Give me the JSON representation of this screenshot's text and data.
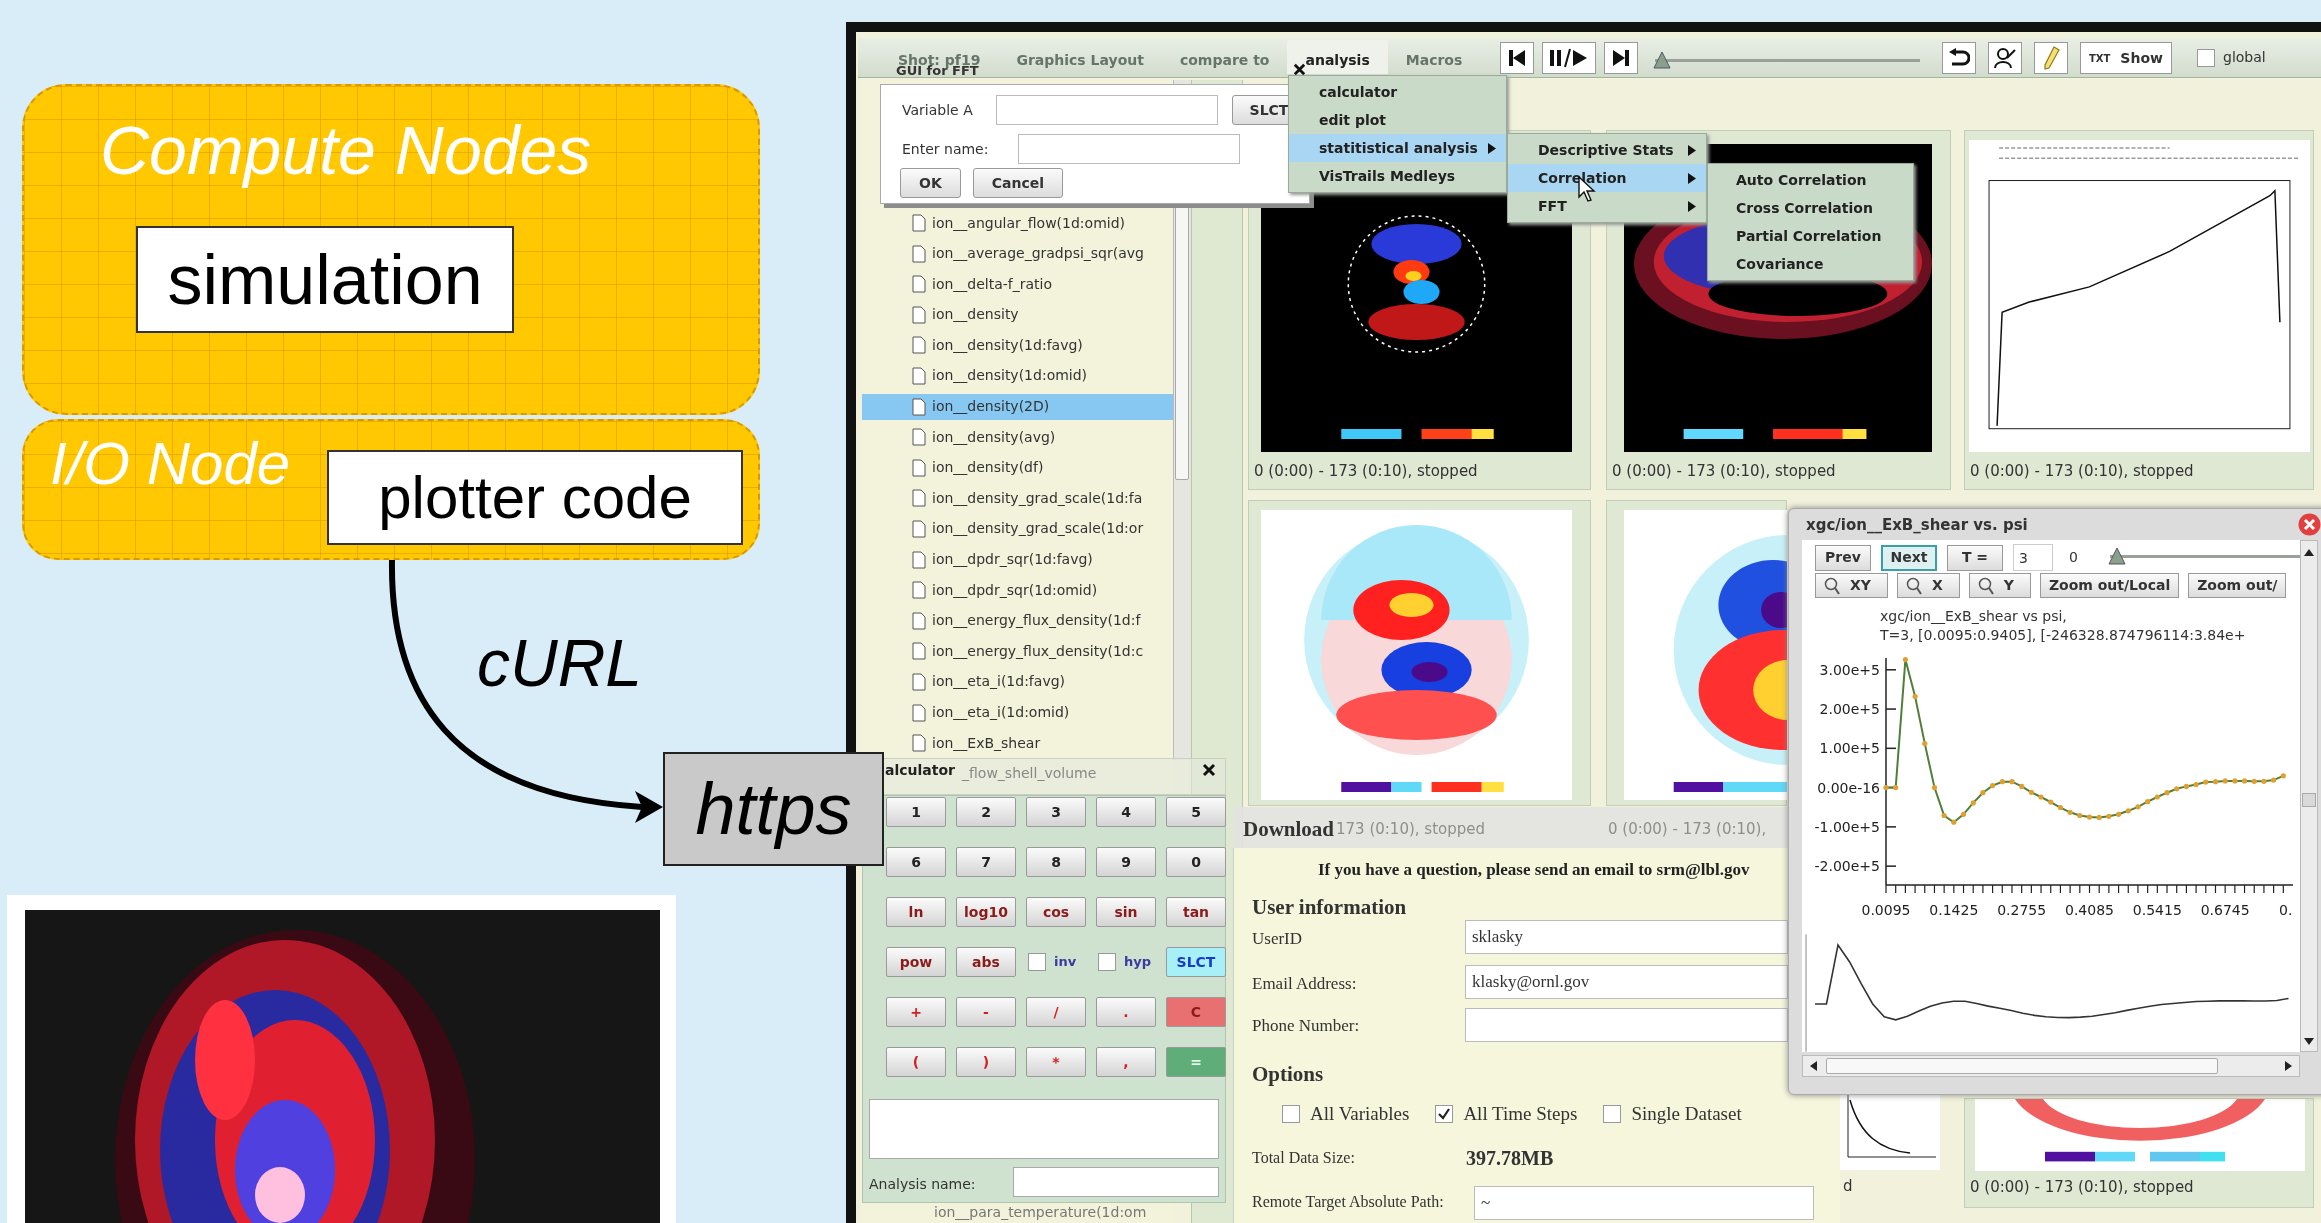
{
  "slide": {
    "compute_nodes": {
      "title": "Compute Nodes",
      "process": "simulation"
    },
    "io_node": {
      "title": "I/O Node",
      "process": "plotter code"
    },
    "transfer_label": "cURL",
    "endpoint": "https"
  },
  "app": {
    "menu_tabs": [
      {
        "label": "Shot: pf19",
        "selected": false
      },
      {
        "label": "Graphics Layout",
        "selected": false
      },
      {
        "label": "compare to",
        "selected": false
      },
      {
        "label": "analysis",
        "selected": true
      },
      {
        "label": "Macros",
        "selected": false
      }
    ],
    "playback": {
      "level": 0
    },
    "show_button": {
      "badge": "TXT",
      "label": "Show"
    },
    "global_toggle": {
      "label": "global",
      "checked": false
    },
    "analysis_menu": [
      {
        "label": "calculator",
        "selected": false,
        "submenu": false
      },
      {
        "label": "edit plot",
        "selected": false,
        "submenu": false
      },
      {
        "label": "statitistical analysis",
        "selected": true,
        "submenu": true
      },
      {
        "label": "VisTrails Medleys",
        "selected": false,
        "submenu": false
      }
    ],
    "stats_menu": [
      {
        "label": "Descriptive Stats",
        "selected": false,
        "submenu": true
      },
      {
        "label": "Correlation",
        "selected": true,
        "submenu": true
      },
      {
        "label": "FFT",
        "selected": false,
        "submenu": true
      }
    ],
    "correlation_menu": [
      {
        "label": "Auto Correlation",
        "selected": false
      },
      {
        "label": "Cross Correlation",
        "selected": false
      },
      {
        "label": "Partial Correlation",
        "selected": false
      },
      {
        "label": "Covariance",
        "selected": false
      }
    ],
    "fft_dialog": {
      "title": "GUI for FFT",
      "variable_label": "Variable A",
      "select_button": "SLCT",
      "name_label": "Enter name:",
      "buttons": [
        "OK",
        "Cancel"
      ]
    },
    "variables": [
      {
        "label": "ion__angular_flow(1d:omid)",
        "selected": false
      },
      {
        "label": "ion__average_gradpsi_sqr(avg",
        "selected": false
      },
      {
        "label": "ion__delta-f_ratio",
        "selected": false
      },
      {
        "label": "ion__density",
        "selected": false
      },
      {
        "label": "ion__density(1d:favg)",
        "selected": false
      },
      {
        "label": "ion__density(1d:omid)",
        "selected": false
      },
      {
        "label": "ion__density(2D)",
        "selected": true
      },
      {
        "label": "ion__density(avg)",
        "selected": false
      },
      {
        "label": "ion__density(df)",
        "selected": false
      },
      {
        "label": "ion__density_grad_scale(1d:fa",
        "selected": false
      },
      {
        "label": "ion__density_grad_scale(1d:or",
        "selected": false
      },
      {
        "label": "ion__dpdr_sqr(1d:favg)",
        "selected": false
      },
      {
        "label": "ion__dpdr_sqr(1d:omid)",
        "selected": false
      },
      {
        "label": "ion__energy_flux_density(1d:f",
        "selected": false
      },
      {
        "label": "ion__energy_flux_density(1d:c",
        "selected": false
      },
      {
        "label": "ion__eta_i(1d:favg)",
        "selected": false
      },
      {
        "label": "ion__eta_i(1d:omid)",
        "selected": false
      },
      {
        "label": "ion__ExB_shear",
        "selected": false
      }
    ],
    "variables_partial": "_flow_shell_volume",
    "variables_tail": "ion__para_temperature(1d:om",
    "thumbnail_captions": [
      "0 (0:00) - 173 (0:10), stopped",
      "0 (0:00) - 173 (0:10), stopped",
      "0 (0:00) - 173 (0:10), stopped"
    ],
    "faded_captions": [
      "173 (0:10), stopped",
      "0 (0:00) - 173 (0:10),"
    ],
    "lower_captions": [
      "d",
      "0 (0:00) - 173 (0:10), stopped"
    ],
    "calculator": {
      "title": "alculator",
      "keys": [
        {
          "label": "1",
          "kind": "digit"
        },
        {
          "label": "2",
          "kind": "digit"
        },
        {
          "label": "3",
          "kind": "digit"
        },
        {
          "label": "4",
          "kind": "digit"
        },
        {
          "label": "5",
          "kind": "digit"
        },
        {
          "label": "6",
          "kind": "digit"
        },
        {
          "label": "7",
          "kind": "digit"
        },
        {
          "label": "8",
          "kind": "digit"
        },
        {
          "label": "9",
          "kind": "digit"
        },
        {
          "label": "0",
          "kind": "digit"
        },
        {
          "label": "ln",
          "kind": "func"
        },
        {
          "label": "log10",
          "kind": "func"
        },
        {
          "label": "cos",
          "kind": "func"
        },
        {
          "label": "sin",
          "kind": "func"
        },
        {
          "label": "tan",
          "kind": "func"
        },
        {
          "label": "pow",
          "kind": "func"
        },
        {
          "label": "abs",
          "kind": "func"
        },
        {
          "label": "inv",
          "kind": "toggle",
          "checked": false
        },
        {
          "label": "hyp",
          "kind": "toggle",
          "checked": false
        },
        {
          "label": "SLCT",
          "kind": "select"
        },
        {
          "label": "+",
          "kind": "op"
        },
        {
          "label": "-",
          "kind": "op"
        },
        {
          "label": "/",
          "kind": "op"
        },
        {
          "label": ".",
          "kind": "op"
        },
        {
          "label": "C",
          "kind": "clear"
        },
        {
          "label": "(",
          "kind": "op"
        },
        {
          "label": ")",
          "kind": "op"
        },
        {
          "label": "*",
          "kind": "op"
        },
        {
          "label": ",",
          "kind": "op"
        },
        {
          "label": "=",
          "kind": "equals"
        }
      ],
      "name_label": "Analysis name:"
    },
    "download": {
      "title": "Download",
      "notice": "If you have a question, please send an email to srm@lbl.gov",
      "user_heading": "User information",
      "fields": [
        {
          "label": "UserID",
          "value": "sklasky"
        },
        {
          "label": "Email Address:",
          "value": "klasky@ornl.gov"
        },
        {
          "label": "Phone Number:"
        }
      ],
      "options_heading": "Options",
      "options": [
        {
          "label": "All Variables",
          "checked": false
        },
        {
          "label": "All Time Steps",
          "checked": true
        },
        {
          "label": "Single Dataset",
          "checked": false
        }
      ],
      "size_label": "Total Data Size:",
      "size_value": "397.78MB",
      "path_label": "Remote Target Absolute Path:",
      "path_value": "~"
    },
    "plot_window": {
      "title": "xgc/ion__ExB_shear vs. psi",
      "nav_buttons": [
        {
          "label": "Prev",
          "selected": false
        },
        {
          "label": "Next",
          "selected": true
        },
        {
          "label": "T =",
          "selected": false
        }
      ],
      "time_value": "3",
      "time_reading": "0",
      "time_slider": {
        "level": 0
      },
      "zoom_buttons": [
        {
          "label": "XY",
          "kind": "zoom"
        },
        {
          "label": "X",
          "kind": "zoom"
        },
        {
          "label": "Y",
          "kind": "zoom"
        },
        {
          "label": "Zoom out/Local",
          "kind": "plain"
        },
        {
          "label": "Zoom out/",
          "kind": "plain"
        }
      ],
      "xtick_fragment": "0.",
      "plot_title": [
        "xgc/ion__ExB_shear vs psi,",
        "T=3, [0.0095:0.9405], [-246328.874796114:3.84e+"
      ],
      "chart_data": {
        "type": "line",
        "x": [
          0.0095,
          0.0285,
          0.0475,
          0.0665,
          0.0855,
          0.1045,
          0.1235,
          0.1425,
          0.1615,
          0.1805,
          0.1995,
          0.2185,
          0.2375,
          0.2565,
          0.2755,
          0.2945,
          0.3135,
          0.3325,
          0.3515,
          0.3705,
          0.3895,
          0.4085,
          0.4275,
          0.4465,
          0.4655,
          0.4845,
          0.5035,
          0.5225,
          0.5415,
          0.5605,
          0.5795,
          0.5985,
          0.6175,
          0.6365,
          0.6555,
          0.6745,
          0.6935,
          0.7125,
          0.7315,
          0.7505,
          0.7695,
          0.7885
        ],
        "series": [
          {
            "color": "#4f7f3a",
            "values": [
              0,
              0,
              326000,
              232000,
              112000,
              0,
              -71000,
              -88000,
              -68000,
              -39000,
              -13000,
              5000,
              15000,
              15000,
              3000,
              -12000,
              -24000,
              -37000,
              -51000,
              -63000,
              -71000,
              -75000,
              -76000,
              -73000,
              -68000,
              -59000,
              -49000,
              -36000,
              -24000,
              -13000,
              -3000,
              3000,
              8000,
              14000,
              15000,
              17000,
              17000,
              17000,
              16000,
              16000,
              19000,
              30000
            ]
          }
        ],
        "xlim": [
          0.0095,
          0.8075
        ],
        "ylim": [
          -248000,
          330000
        ],
        "xticks": [
          0.0095,
          0.1425,
          0.2755,
          0.4085,
          0.5415,
          0.6745
        ],
        "yticks": [
          {
            "value": 300000,
            "label": "3.00e+5"
          },
          {
            "value": 200000,
            "label": "2.00e+5"
          },
          {
            "value": 100000,
            "label": "1.00e+5"
          },
          {
            "value": 0,
            "label": "0.00e-16"
          },
          {
            "value": -100000,
            "label": "-1.00e+5"
          },
          {
            "value": -200000,
            "label": "-2.00e+5"
          }
        ]
      }
    }
  }
}
